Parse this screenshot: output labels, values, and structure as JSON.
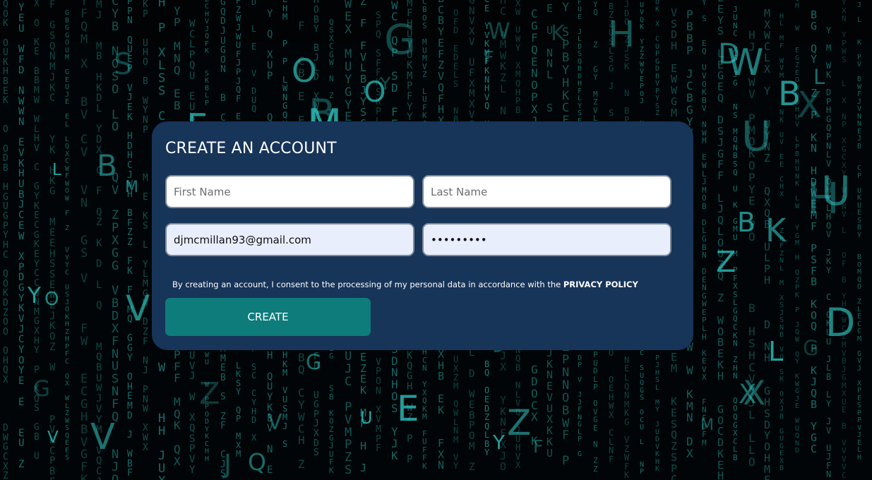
{
  "form": {
    "title": "CREATE AN ACCOUNT",
    "first_name_placeholder": "First Name",
    "last_name_placeholder": "Last Name",
    "email_value": "djmcmillan93@gmail.com",
    "password_value": "pw-9chars",
    "consent_text": "By creating an account, I consent to the processing of my personal data in accordance with the",
    "privacy_link": "PRIVACY POLICY",
    "create_label": "CREATE"
  },
  "background": {
    "description": "matrix-style falling letters",
    "glyph_color": "#2ec4c0",
    "card_color": "#173459",
    "button_color": "#0e7c7b"
  }
}
